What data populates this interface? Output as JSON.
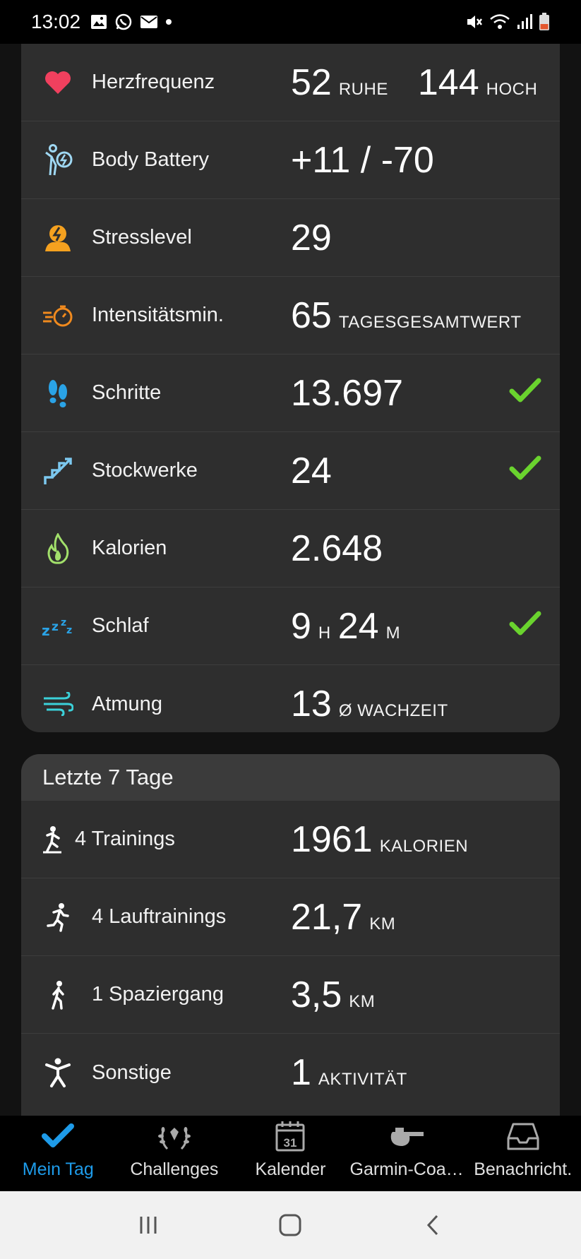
{
  "status_bar": {
    "time": "13:02",
    "left_icons": [
      "gallery-icon",
      "whatsapp-icon",
      "mail-icon",
      "dot-icon"
    ],
    "right_icons": [
      "mute-icon",
      "wifi-icon",
      "signal-icon",
      "battery-icon"
    ]
  },
  "today": {
    "rows": [
      {
        "label": "Herzfrequenz",
        "icon": "heart-icon",
        "values": [
          {
            "num": "52",
            "unit": "RUHE"
          },
          {
            "num": "144",
            "unit": "HOCH"
          }
        ]
      },
      {
        "label": "Body Battery",
        "icon": "body-battery-icon",
        "value": "+11 / -70"
      },
      {
        "label": "Stresslevel",
        "icon": "stress-icon",
        "value": "29"
      },
      {
        "label": "Intensitätsmin.",
        "icon": "stopwatch-icon",
        "value": "65",
        "unit": "TAGESGESAMTWERT"
      },
      {
        "label": "Schritte",
        "icon": "footsteps-icon",
        "value": "13.697",
        "goal_reached": true
      },
      {
        "label": "Stockwerke",
        "icon": "stairs-icon",
        "value": "24",
        "goal_reached": true
      },
      {
        "label": "Kalorien",
        "icon": "flame-icon",
        "value": "2.648"
      },
      {
        "label": "Schlaf",
        "icon": "sleep-icon",
        "hours": "9",
        "hours_unit": "H",
        "minutes": "24",
        "minutes_unit": "M",
        "goal_reached": true
      },
      {
        "label": "Atmung",
        "icon": "breathing-icon",
        "value": "13",
        "unit": "Ø WACHZEIT"
      }
    ]
  },
  "last7": {
    "title": "Letzte 7 Tage",
    "rows": [
      {
        "label": "4 Trainings",
        "icon": "training-icon",
        "value": "1961",
        "unit": "KALORIEN"
      },
      {
        "label": "4 Lauftrainings",
        "icon": "running-icon",
        "value": "21,7",
        "unit": "KM"
      },
      {
        "label": "1 Spaziergang",
        "icon": "walking-icon",
        "value": "3,5",
        "unit": "KM"
      },
      {
        "label": "Sonstige",
        "icon": "person-icon",
        "value": "1",
        "unit": "AKTIVITÄT"
      }
    ]
  },
  "nav": {
    "items": [
      {
        "label": "Mein Tag",
        "icon": "checkmark-icon",
        "active": true
      },
      {
        "label": "Challenges",
        "icon": "laurel-icon"
      },
      {
        "label": "Kalender",
        "icon": "calendar-icon",
        "day": "31"
      },
      {
        "label": "Garmin-Coa…",
        "icon": "whistle-icon"
      },
      {
        "label": "Benachricht.",
        "icon": "inbox-icon"
      }
    ]
  },
  "colors": {
    "accent": "#1e9be9",
    "check": "#6ad32e",
    "heart": "#f0405e",
    "stress": "#f5a11f",
    "intensity": "#f08a1e",
    "steps": "#2aa3e6",
    "stairs": "#7cc8ef",
    "calories": "#a2e06b",
    "sleep": "#2aa3e6",
    "breathing": "#3bd1d9"
  }
}
